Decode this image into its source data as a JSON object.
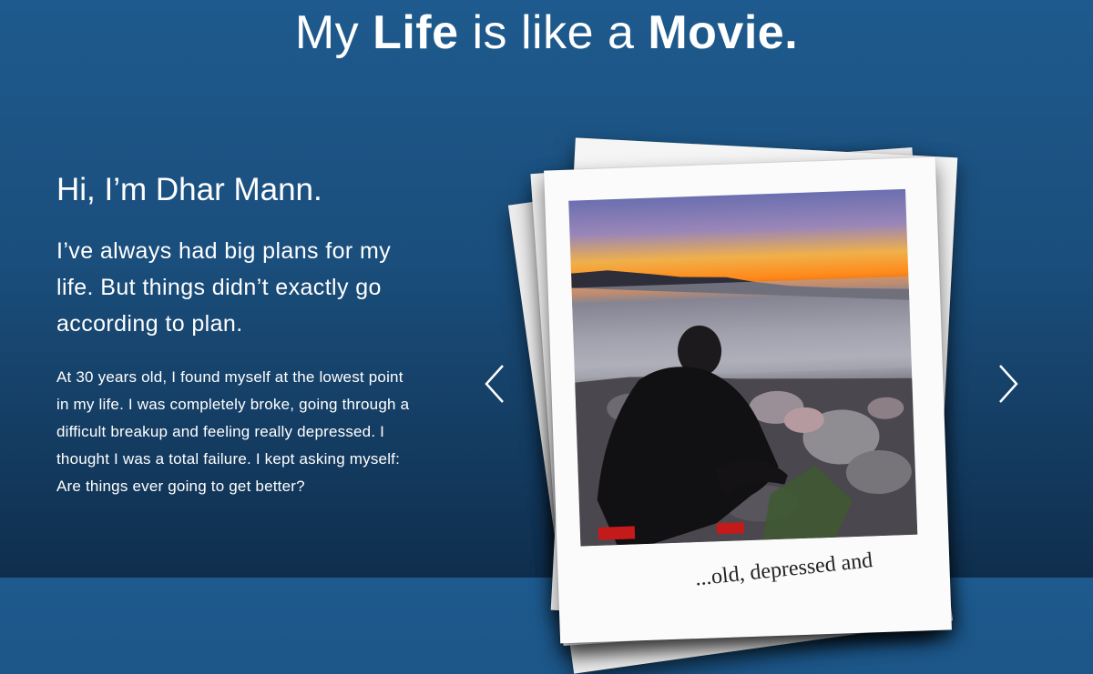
{
  "header": {
    "title_part1": "My ",
    "title_bold1": "Life",
    "title_part2": " is like a ",
    "title_bold2": "Movie."
  },
  "intro": {
    "greeting": "Hi, I’m Dhar Mann.",
    "lead": "I’ve always had big plans for my life. But things didn’t exactly go according to plan.",
    "body": "At 30 years old, I found myself at the lowest point in my life. I was completely broke, going through a difficult breakup and feeling really depressed. I thought I was a total failure. I kept asking myself: Are things ever going to get better?"
  },
  "carousel": {
    "prev_icon": "chevron-left-icon",
    "next_icon": "chevron-right-icon",
    "caption": "...old, depressed and"
  },
  "colors": {
    "background_top": "#1e5a8e",
    "background_bottom": "#0f2e4d",
    "text": "#ffffff"
  }
}
